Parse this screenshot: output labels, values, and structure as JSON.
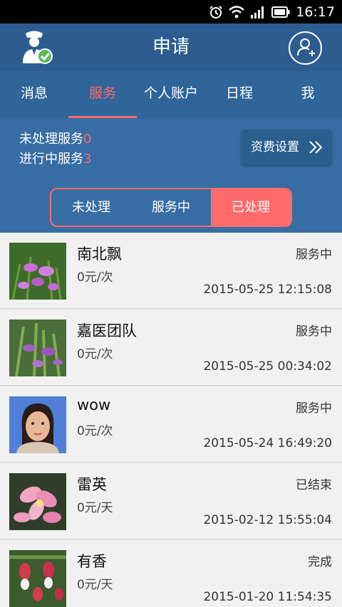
{
  "status_bar": {
    "time": "16:17",
    "icons": [
      "alarm-icon",
      "wifi-icon",
      "signal-icon",
      "battery-icon"
    ]
  },
  "header": {
    "title": "申请",
    "logo_icon": "service-agent-check-icon",
    "profile_icon": "add-user-icon"
  },
  "tabs": [
    {
      "label": "消息",
      "active": false
    },
    {
      "label": "服务",
      "active": true
    },
    {
      "label": "个人账户",
      "active": false
    },
    {
      "label": "日程",
      "active": false
    },
    {
      "label": "我",
      "active": false
    }
  ],
  "summary": {
    "pending_label": "未处理服务",
    "pending_count": "0",
    "in_progress_label": "进行中服务",
    "in_progress_count": "3",
    "fee_button": "资费设置"
  },
  "segments": [
    {
      "label": "未处理",
      "active": false
    },
    {
      "label": "服务中",
      "active": false
    },
    {
      "label": "已处理",
      "active": true
    }
  ],
  "list": [
    {
      "name": "南北飘",
      "price": "0元/次",
      "status": "服务中",
      "time": "2015-05-25 12:15:08",
      "avatar": "purple-flower-photo"
    },
    {
      "name": "嘉医团队",
      "price": "0元/次",
      "status": "服务中",
      "time": "2015-05-25 00:34:02",
      "avatar": "purple-orchid-photo"
    },
    {
      "name": "wow",
      "price": "0元/次",
      "status": "服务中",
      "time": "2015-05-24 16:49:20",
      "avatar": "portrait-photo"
    },
    {
      "name": "雷英",
      "price": "0元/天",
      "status": "已结束",
      "time": "2015-02-12 15:55:04",
      "avatar": "pink-flower-photo"
    },
    {
      "name": "有香",
      "price": "0元/天",
      "status": "完成",
      "time": "2015-01-20 11:54:35",
      "avatar": "fuchsia-flower-photo"
    }
  ],
  "colors": {
    "header": "#2d5d90",
    "tabs": "#2f6599",
    "summary": "#376da3",
    "accent": "#ff6b6b"
  }
}
